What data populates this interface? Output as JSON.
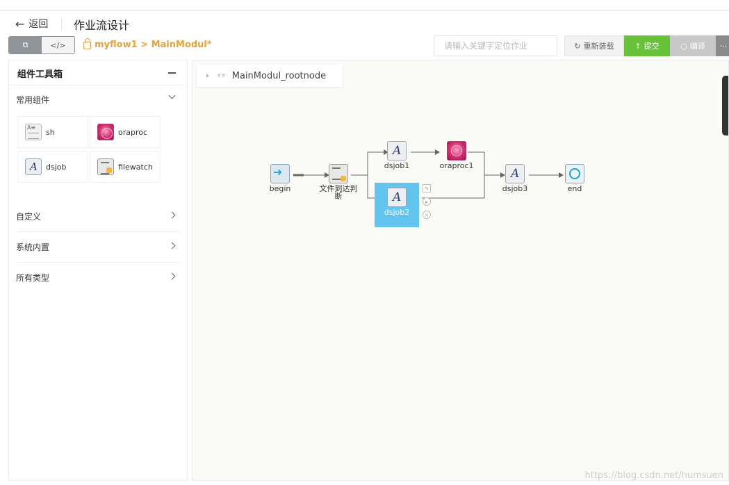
{
  "header": {
    "back_label": "返回",
    "page_title": "作业流设计"
  },
  "toolbar": {
    "view_toggle": [
      {
        "label": "⧉",
        "icon": "diagram-view-icon"
      },
      {
        "label": "</>",
        "icon": "code-view-icon"
      }
    ],
    "breadcrumb": "myflow1 > MainModul*",
    "search_placeholder": "请输入关键字定位作业",
    "reload_label": "重新装载",
    "submit_label": "提交",
    "compile_label": "编译",
    "more_label": "···",
    "colors": {
      "submit": "#67c23a",
      "breadcrumb": "#e6a23c",
      "selected_node": "#62c4ef"
    }
  },
  "sidebar": {
    "title": "组件工具箱",
    "common_group": "常用组件",
    "components": [
      {
        "label": "sh",
        "icon": "shell-doc-icon"
      },
      {
        "label": "oraproc",
        "icon": "database-icon"
      },
      {
        "label": "dsjob",
        "icon": "dsjob-icon"
      },
      {
        "label": "filewatch",
        "icon": "filewatch-icon"
      }
    ],
    "groups": [
      "自定义",
      "系统内置",
      "所有类型"
    ]
  },
  "canvas": {
    "root_label": "MainModul_rootnode",
    "nodes": {
      "begin": "begin",
      "filecheck": "文件到达判断",
      "dsjob1": "dsjob1",
      "oraproc1": "oraproc1",
      "dsjob2": "dsjob2",
      "dsjob3": "dsjob3",
      "end": "end"
    },
    "selected_node": "dsjob2"
  },
  "watermark": "https://blog.csdn.net/humsuen"
}
